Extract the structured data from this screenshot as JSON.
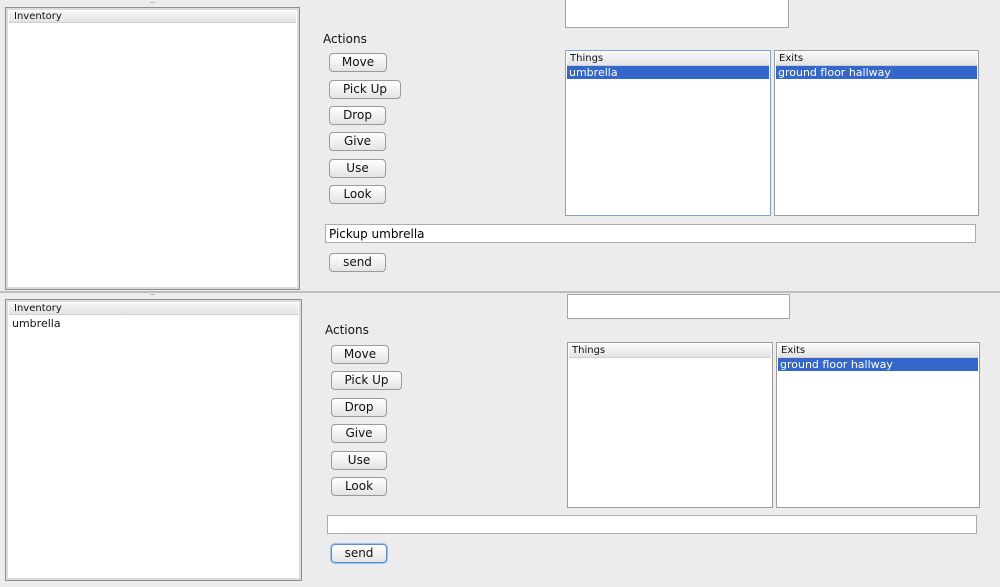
{
  "top": {
    "inventory": {
      "header": "Inventory",
      "items": []
    },
    "actions_label": "Actions",
    "buttons": {
      "move": "Move",
      "pick_up": "Pick Up",
      "drop": "Drop",
      "give": "Give",
      "use": "Use",
      "look": "Look"
    },
    "things": {
      "header": "Things",
      "items": [
        "umbrella"
      ]
    },
    "exits": {
      "header": "Exits",
      "items": [
        "ground floor hallway"
      ]
    },
    "command": {
      "value": "Pickup umbrella"
    },
    "send_label": "send"
  },
  "bottom": {
    "inventory": {
      "header": "Inventory",
      "items": [
        "umbrella"
      ]
    },
    "actions_label": "Actions",
    "buttons": {
      "move": "Move",
      "pick_up": "Pick Up",
      "drop": "Drop",
      "give": "Give",
      "use": "Use",
      "look": "Look"
    },
    "things": {
      "header": "Things",
      "items": []
    },
    "exits": {
      "header": "Exits",
      "items": [
        "ground floor hallway"
      ]
    },
    "command": {
      "value": ""
    },
    "send_label": "send"
  }
}
